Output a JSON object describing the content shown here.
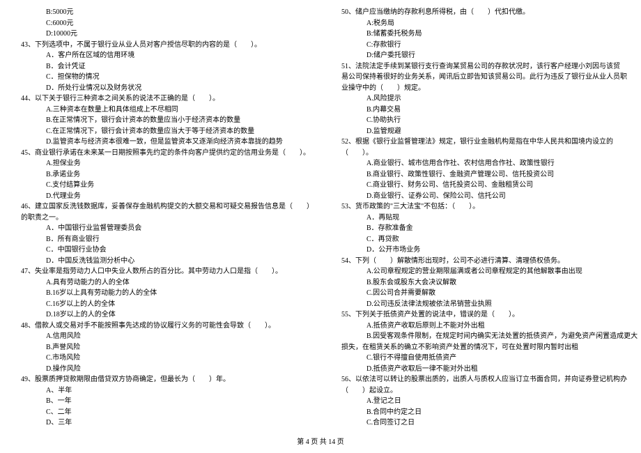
{
  "footer": "第 4 页 共 14 页",
  "left": [
    {
      "cls": "opt",
      "t": "B:5000元"
    },
    {
      "cls": "opt",
      "t": "C:6000元"
    },
    {
      "cls": "opt",
      "t": "D:10000元"
    },
    {
      "cls": "q",
      "t": "43、下列选项中，不属于银行业从业人员对客户授信尽职的内容的是（　　）。"
    },
    {
      "cls": "opt",
      "t": "A．客户所在区域的信用环境"
    },
    {
      "cls": "opt",
      "t": "B．会计凭证"
    },
    {
      "cls": "opt",
      "t": "C．担保物的情况"
    },
    {
      "cls": "opt",
      "t": "D．所处行业情况以及财务状况"
    },
    {
      "cls": "q",
      "t": "44、以下关于银行三种资本之间关系的说法不正确的是（　　）。"
    },
    {
      "cls": "opt",
      "t": "A.三种资本在数量上和具体组成上不尽相同"
    },
    {
      "cls": "opt",
      "t": "B.在正常情况下，银行会计资本的数量应当小于经济资本的数量"
    },
    {
      "cls": "opt",
      "t": "C.在正常情况下，银行会计资本的数量应当大于等于经济资本的数量"
    },
    {
      "cls": "opt",
      "t": "D.监管资本与经济资本很难一致，但是监管资本又逐渐向经济资本靠拢的趋势"
    },
    {
      "cls": "q",
      "t": "45、商业银行承诺在未来某一日期按照事先约定的条件向客户提供约定的信用业务是（　　）。"
    },
    {
      "cls": "opt",
      "t": "A.担保业务"
    },
    {
      "cls": "opt",
      "t": "B.承诺业务"
    },
    {
      "cls": "opt",
      "t": "C.支付结算业务"
    },
    {
      "cls": "opt",
      "t": "D.代理业务"
    },
    {
      "cls": "q",
      "t": "46、建立国家反洗钱数据库，妥善保存金融机构提交的大额交易和可疑交易报告信息是（　　）"
    },
    {
      "cls": "cont",
      "t": "的职责之一。"
    },
    {
      "cls": "opt",
      "t": "A．中国银行业监督管理委员会"
    },
    {
      "cls": "opt",
      "t": "B．所有商业银行"
    },
    {
      "cls": "opt",
      "t": "C．中国银行业协会"
    },
    {
      "cls": "opt",
      "t": "D．中国反洗钱监测分析中心"
    },
    {
      "cls": "q",
      "t": "47、失业率是指劳动力人口中失业人数所占的百分比。其中劳动力人口是指（　　）。"
    },
    {
      "cls": "opt",
      "t": "A.具有劳动能力的人的全体"
    },
    {
      "cls": "opt",
      "t": "B.16岁以上具有劳动能力的人的全体"
    },
    {
      "cls": "opt",
      "t": "C.16岁以上的人的全体"
    },
    {
      "cls": "opt",
      "t": "D.18岁以上的人的全体"
    },
    {
      "cls": "q",
      "t": "48、借款人或交易对手不能按照事先达成的协议履行义务的可能性会导致（　　）。"
    },
    {
      "cls": "opt",
      "t": "A.信用风险"
    },
    {
      "cls": "opt",
      "t": "B.声誉风险"
    },
    {
      "cls": "opt",
      "t": "C.市场风险"
    },
    {
      "cls": "opt",
      "t": "D.操作风险"
    },
    {
      "cls": "q",
      "t": "49、股票质押贷款期限由借贷双方协商确定，但最长为（　　）年。"
    },
    {
      "cls": "opt",
      "t": "A、半年"
    },
    {
      "cls": "opt",
      "t": "B、一年"
    },
    {
      "cls": "opt",
      "t": "C、二年"
    },
    {
      "cls": "opt",
      "t": "D、三年"
    }
  ],
  "right": [
    {
      "cls": "q",
      "t": "50、储户应当缴纳的存款利息所得税，由（　　）代扣代缴。"
    },
    {
      "cls": "opt",
      "t": "A:税务局"
    },
    {
      "cls": "opt",
      "t": "B:储蓄委托税务局"
    },
    {
      "cls": "opt",
      "t": "C:存款银行"
    },
    {
      "cls": "opt",
      "t": "D:储户委托银行"
    },
    {
      "cls": "q",
      "t": "51、法院法定手续到某银行支行查询某贸易公司的存款状况时，该行客户经理小刘因与该贸"
    },
    {
      "cls": "cont",
      "t": "易公司保持着很好的业务关系，闻讯后立即告知该贸易公司。此行为违反了银行业从业人员职"
    },
    {
      "cls": "cont",
      "t": "业操守中的（　　）规定。"
    },
    {
      "cls": "opt",
      "t": "A.风险提示"
    },
    {
      "cls": "opt",
      "t": "B.内幕交易"
    },
    {
      "cls": "opt",
      "t": "C.协助执行"
    },
    {
      "cls": "opt",
      "t": "D.监管规避"
    },
    {
      "cls": "q",
      "t": "52、根据《银行业监督管理法》规定，银行业金融机构是指在中华人民共和国境内设立的"
    },
    {
      "cls": "cont",
      "t": "（　　）。"
    },
    {
      "cls": "opt",
      "t": "A.商业银行、城市信用合作社、农村信用合作社、政策性银行"
    },
    {
      "cls": "opt",
      "t": "B.商业银行、政策性银行、金融资产管理公司、信托投资公司"
    },
    {
      "cls": "opt",
      "t": "C.商业银行、财务公司、信托投资公司、金融租赁公司"
    },
    {
      "cls": "opt",
      "t": "D.商业银行、证券公司、保险公司、信托公司"
    },
    {
      "cls": "q",
      "t": "53、货币政策的\"三大法宝\"不包括：（　　）。"
    },
    {
      "cls": "opt",
      "t": "A．再贴现"
    },
    {
      "cls": "opt",
      "t": "B．存款准备金"
    },
    {
      "cls": "opt",
      "t": "C．再贷款"
    },
    {
      "cls": "opt",
      "t": "D．公开市场业务"
    },
    {
      "cls": "q",
      "t": "54、下列（　　）解散情形出现时，公司不必进行清算、清理债权债务。"
    },
    {
      "cls": "opt",
      "t": "A.公司章程规定的营业期限届满或者公司章程规定的其他解散事由出现"
    },
    {
      "cls": "opt",
      "t": "B.股东会或股东大会决议解散"
    },
    {
      "cls": "opt",
      "t": "C.因公司合并需要解散"
    },
    {
      "cls": "opt",
      "t": "D.公司违反法律法规被依法吊销营业执照"
    },
    {
      "cls": "q",
      "t": "55、下列关于抵债资产处置的说法中，错误的是（　　）。"
    },
    {
      "cls": "opt",
      "t": "A.抵债资产收取后原则上不能对外出租"
    },
    {
      "cls": "opt",
      "t": "B.因受客观条件限制，在规定时间内确实无法处置的抵债资产，为避免资产闲置造成更大"
    },
    {
      "cls": "cont",
      "t": "损失，在租赁关系的确立不影响资产处置的情况下，可在处置时限内暂时出租"
    },
    {
      "cls": "opt",
      "t": "C.银行不得擅自使用抵债资产"
    },
    {
      "cls": "opt",
      "t": "D.抵债资产收取后一律不能对外出租"
    },
    {
      "cls": "q",
      "t": "56、以依法可以转让的股票出质的，出质人与质权人应当订立书面合同，并向证券登记机构办"
    },
    {
      "cls": "cont",
      "t": "（　　）起设立。"
    },
    {
      "cls": "opt",
      "t": "A.登记之日"
    },
    {
      "cls": "opt",
      "t": "B.合同中约定之日"
    },
    {
      "cls": "opt",
      "t": "C.合同签订之日"
    }
  ]
}
